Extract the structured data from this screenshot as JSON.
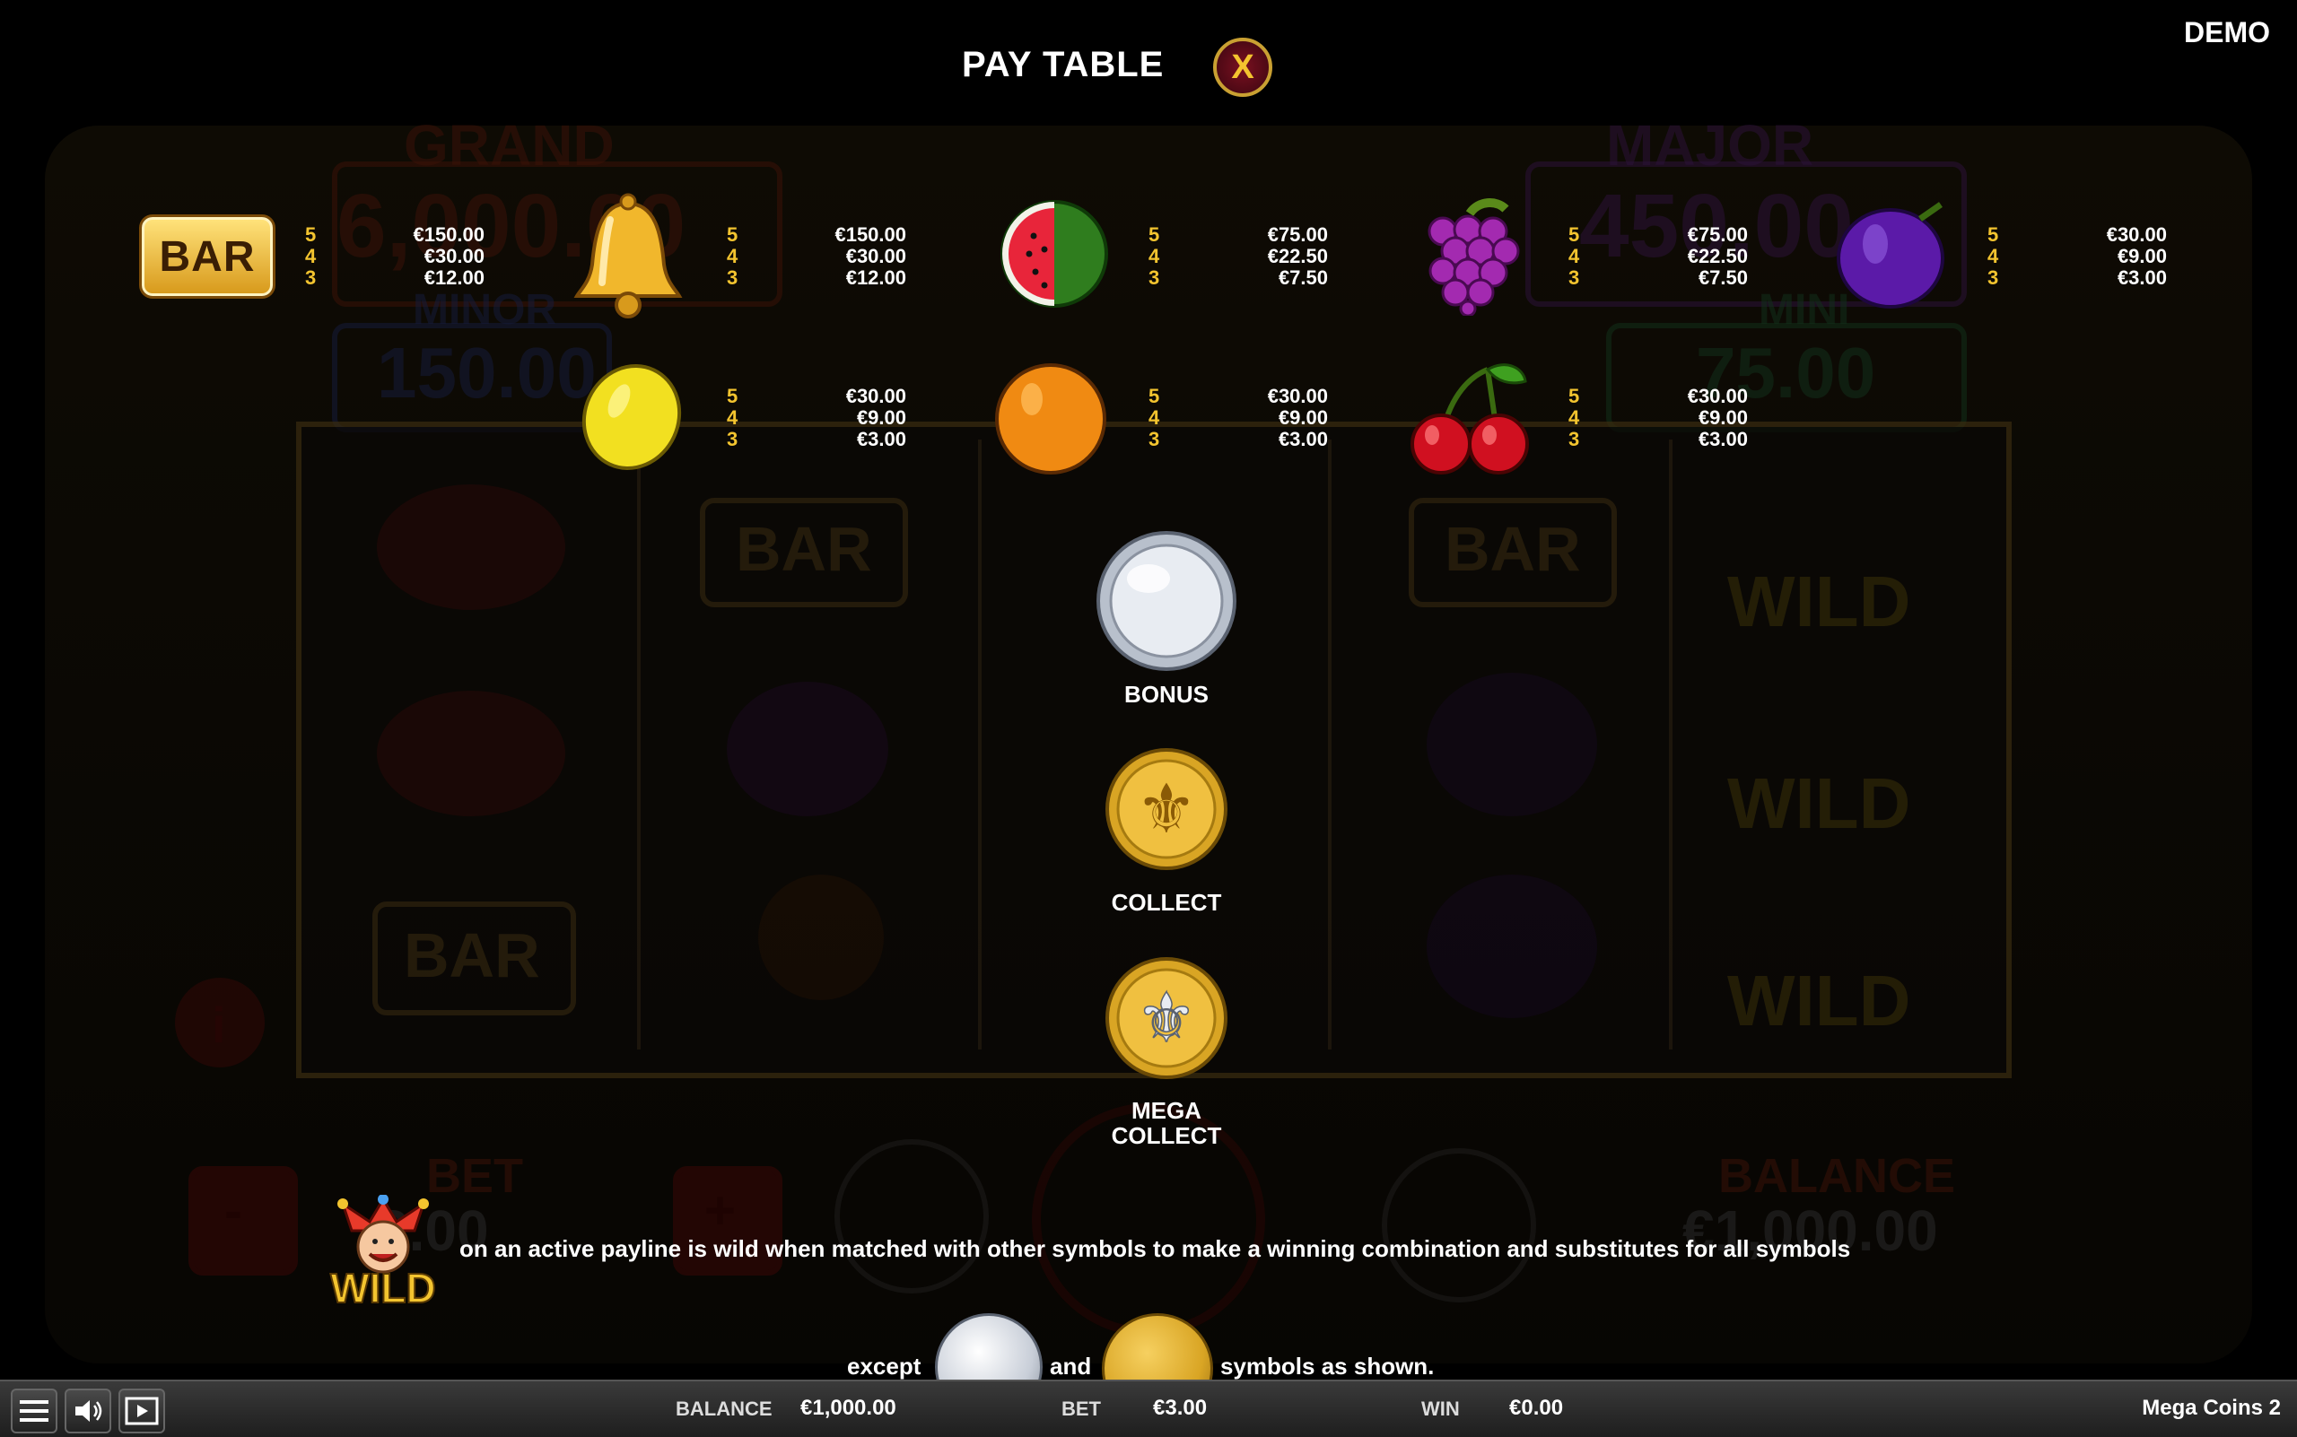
{
  "header": {
    "title": "PAY TABLE",
    "close_label": "X",
    "mode_badge": "DEMO"
  },
  "background": {
    "grand_label": "GRAND",
    "grand_value": "6,000.00",
    "major_label": "MAJOR",
    "major_value": "450.00",
    "minor_label": "MINOR",
    "minor_value": "150.00",
    "mini_label": "MINI",
    "mini_value": "75.00",
    "bet_label": "BET",
    "bet_value": "3.00",
    "balance_label": "BALANCE",
    "balance_value": "€1,000.00",
    "reel_bar": "BAR",
    "reel_wild": "WILD",
    "info": "i",
    "minus": "-",
    "plus": "+"
  },
  "paytable": {
    "row1": [
      {
        "name": "bar",
        "lines": [
          {
            "count": "5",
            "pay": "€150.00"
          },
          {
            "count": "4",
            "pay": "€30.00"
          },
          {
            "count": "3",
            "pay": "€12.00"
          }
        ]
      },
      {
        "name": "bell",
        "lines": [
          {
            "count": "5",
            "pay": "€150.00"
          },
          {
            "count": "4",
            "pay": "€30.00"
          },
          {
            "count": "3",
            "pay": "€12.00"
          }
        ]
      },
      {
        "name": "watermelon",
        "lines": [
          {
            "count": "5",
            "pay": "€75.00"
          },
          {
            "count": "4",
            "pay": "€22.50"
          },
          {
            "count": "3",
            "pay": "€7.50"
          }
        ]
      },
      {
        "name": "grapes",
        "lines": [
          {
            "count": "5",
            "pay": "€75.00"
          },
          {
            "count": "4",
            "pay": "€22.50"
          },
          {
            "count": "3",
            "pay": "€7.50"
          }
        ]
      },
      {
        "name": "plum",
        "lines": [
          {
            "count": "5",
            "pay": "€30.00"
          },
          {
            "count": "4",
            "pay": "€9.00"
          },
          {
            "count": "3",
            "pay": "€3.00"
          }
        ]
      }
    ],
    "row2": [
      {
        "name": "lemon",
        "lines": [
          {
            "count": "5",
            "pay": "€30.00"
          },
          {
            "count": "4",
            "pay": "€9.00"
          },
          {
            "count": "3",
            "pay": "€3.00"
          }
        ]
      },
      {
        "name": "orange",
        "lines": [
          {
            "count": "5",
            "pay": "€30.00"
          },
          {
            "count": "4",
            "pay": "€9.00"
          },
          {
            "count": "3",
            "pay": "€3.00"
          }
        ]
      },
      {
        "name": "cherries",
        "lines": [
          {
            "count": "5",
            "pay": "€30.00"
          },
          {
            "count": "4",
            "pay": "€9.00"
          },
          {
            "count": "3",
            "pay": "€3.00"
          }
        ]
      }
    ],
    "bar_symbol_text": "BAR"
  },
  "specials": {
    "bonus": "BONUS",
    "collect": "COLLECT",
    "mega_collect_1": "MEGA",
    "mega_collect_2": "COLLECT"
  },
  "wild": {
    "symbol_text": "WILD",
    "line1": "on an active payline is wild when matched with other symbols to make a winning combination and substitutes for all symbols",
    "except": "except",
    "and": "and",
    "tail": "symbols as shown."
  },
  "bottombar": {
    "balance_label": "BALANCE",
    "balance_value": "€1,000.00",
    "bet_label": "BET",
    "bet_value": "€3.00",
    "win_label": "WIN",
    "win_value": "€0.00",
    "game_name": "Mega Coins 2"
  },
  "icons": [
    "menu-icon",
    "sound-icon",
    "video-icon",
    "close-icon"
  ],
  "colors": {
    "gold": "#f3c42f",
    "close_bg": "#7a1020",
    "background": "#000000"
  }
}
